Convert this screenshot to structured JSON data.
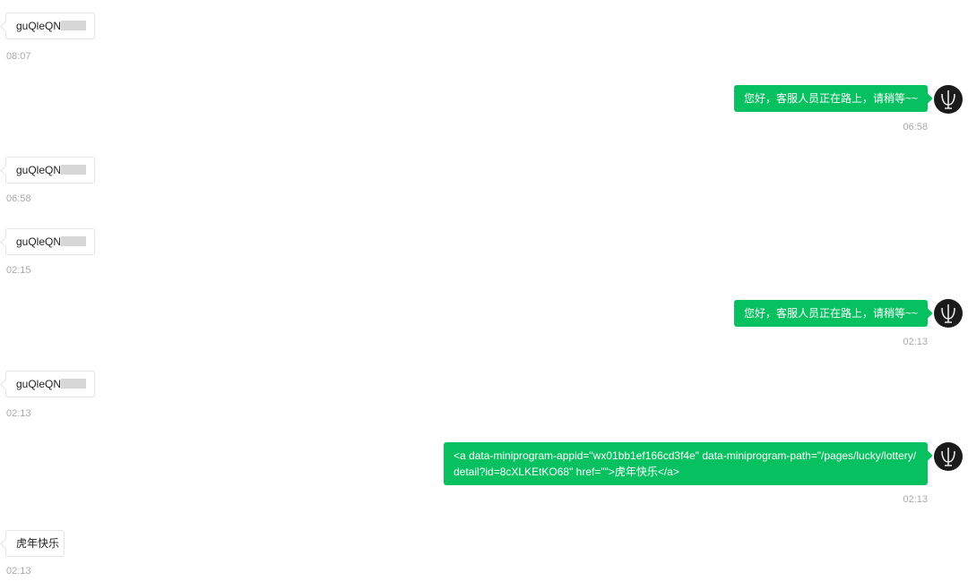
{
  "conversation": {
    "messages": [
      {
        "side": "in",
        "text": "guQleQN",
        "time": "08:07"
      },
      {
        "side": "out",
        "text": "您好，客服人员正在路上，请稍等~~",
        "time": "06:58"
      },
      {
        "side": "in",
        "text": "guQleQN",
        "time": "06:58"
      },
      {
        "side": "in",
        "text": "guQleQN",
        "time": "02:15"
      },
      {
        "side": "out",
        "text": "您好，客服人员正在路上，请稍等~~",
        "time": "02:13"
      },
      {
        "side": "in",
        "text": "guQleQN",
        "time": "02:13"
      },
      {
        "side": "out",
        "text": "<a data-miniprogram-appid=\"wx01bb1ef166cd3f4e\" data-miniprogram-path=\"/pages/lucky/lottery/detail?id=8cXLKEtKO68\" href=\"\">虎年快乐</a>",
        "time": "02:13"
      },
      {
        "side": "in",
        "text": "虎年快乐",
        "time": "02:13"
      }
    ]
  },
  "colors": {
    "outgoing_bubble": "#07c160",
    "incoming_bubble": "#ffffff",
    "timestamp": "#a9a9a9"
  },
  "icons": {
    "agent_avatar": "avatar-icon"
  }
}
